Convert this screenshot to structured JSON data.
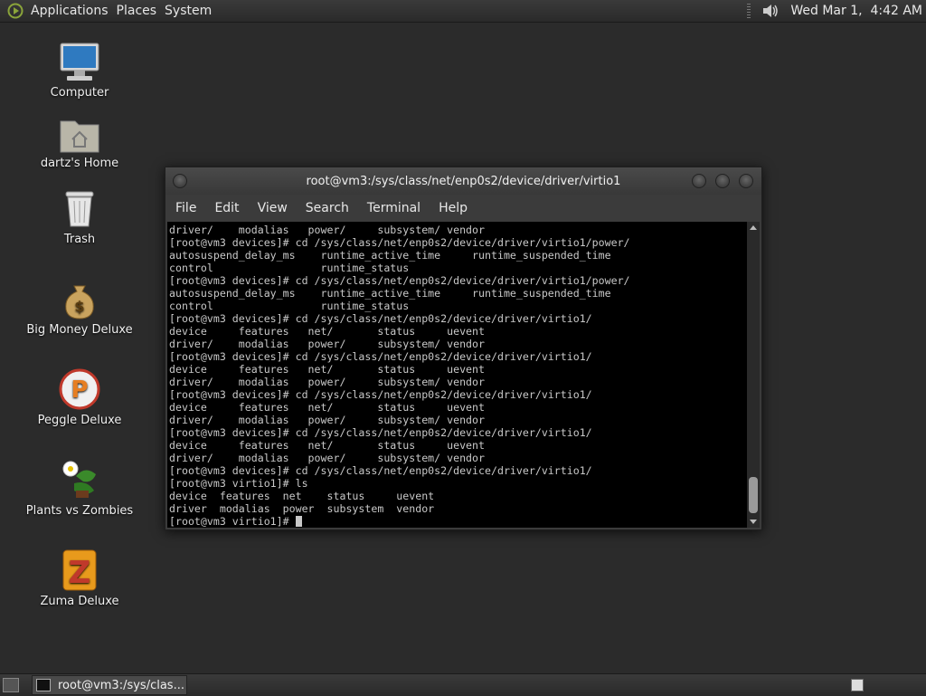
{
  "top_panel": {
    "menus": [
      "Applications",
      "Places",
      "System"
    ],
    "clock": "Wed Mar 1,  4:42 AM"
  },
  "desktop": {
    "icons": [
      {
        "label": "Computer"
      },
      {
        "label": "dartz's Home"
      },
      {
        "label": "Trash"
      },
      {
        "label": "Big Money Deluxe"
      },
      {
        "label": "Peggle Deluxe"
      },
      {
        "label": "Plants vs Zombies"
      },
      {
        "label": "Zuma Deluxe"
      }
    ]
  },
  "terminal": {
    "title": "root@vm3:/sys/class/net/enp0s2/device/driver/virtio1",
    "menu": [
      "File",
      "Edit",
      "View",
      "Search",
      "Terminal",
      "Help"
    ],
    "lines": [
      "driver/    modalias   power/     subsystem/ vendor",
      "[root@vm3 devices]# cd /sys/class/net/enp0s2/device/driver/virtio1/power/",
      "autosuspend_delay_ms    runtime_active_time     runtime_suspended_time",
      "control                 runtime_status",
      "[root@vm3 devices]# cd /sys/class/net/enp0s2/device/driver/virtio1/power/",
      "autosuspend_delay_ms    runtime_active_time     runtime_suspended_time",
      "control                 runtime_status",
      "[root@vm3 devices]# cd /sys/class/net/enp0s2/device/driver/virtio1/",
      "device     features   net/       status     uevent",
      "driver/    modalias   power/     subsystem/ vendor",
      "[root@vm3 devices]# cd /sys/class/net/enp0s2/device/driver/virtio1/",
      "device     features   net/       status     uevent",
      "driver/    modalias   power/     subsystem/ vendor",
      "[root@vm3 devices]# cd /sys/class/net/enp0s2/device/driver/virtio1/",
      "device     features   net/       status     uevent",
      "driver/    modalias   power/     subsystem/ vendor",
      "[root@vm3 devices]# cd /sys/class/net/enp0s2/device/driver/virtio1/",
      "device     features   net/       status     uevent",
      "driver/    modalias   power/     subsystem/ vendor",
      "[root@vm3 devices]# cd /sys/class/net/enp0s2/device/driver/virtio1/",
      "[root@vm3 virtio1]# ls",
      "device  features  net    status     uevent",
      "driver  modalias  power  subsystem  vendor",
      "[root@vm3 virtio1]# "
    ]
  },
  "bottom_panel": {
    "taskbar_item": "root@vm3:/sys/clas..."
  }
}
